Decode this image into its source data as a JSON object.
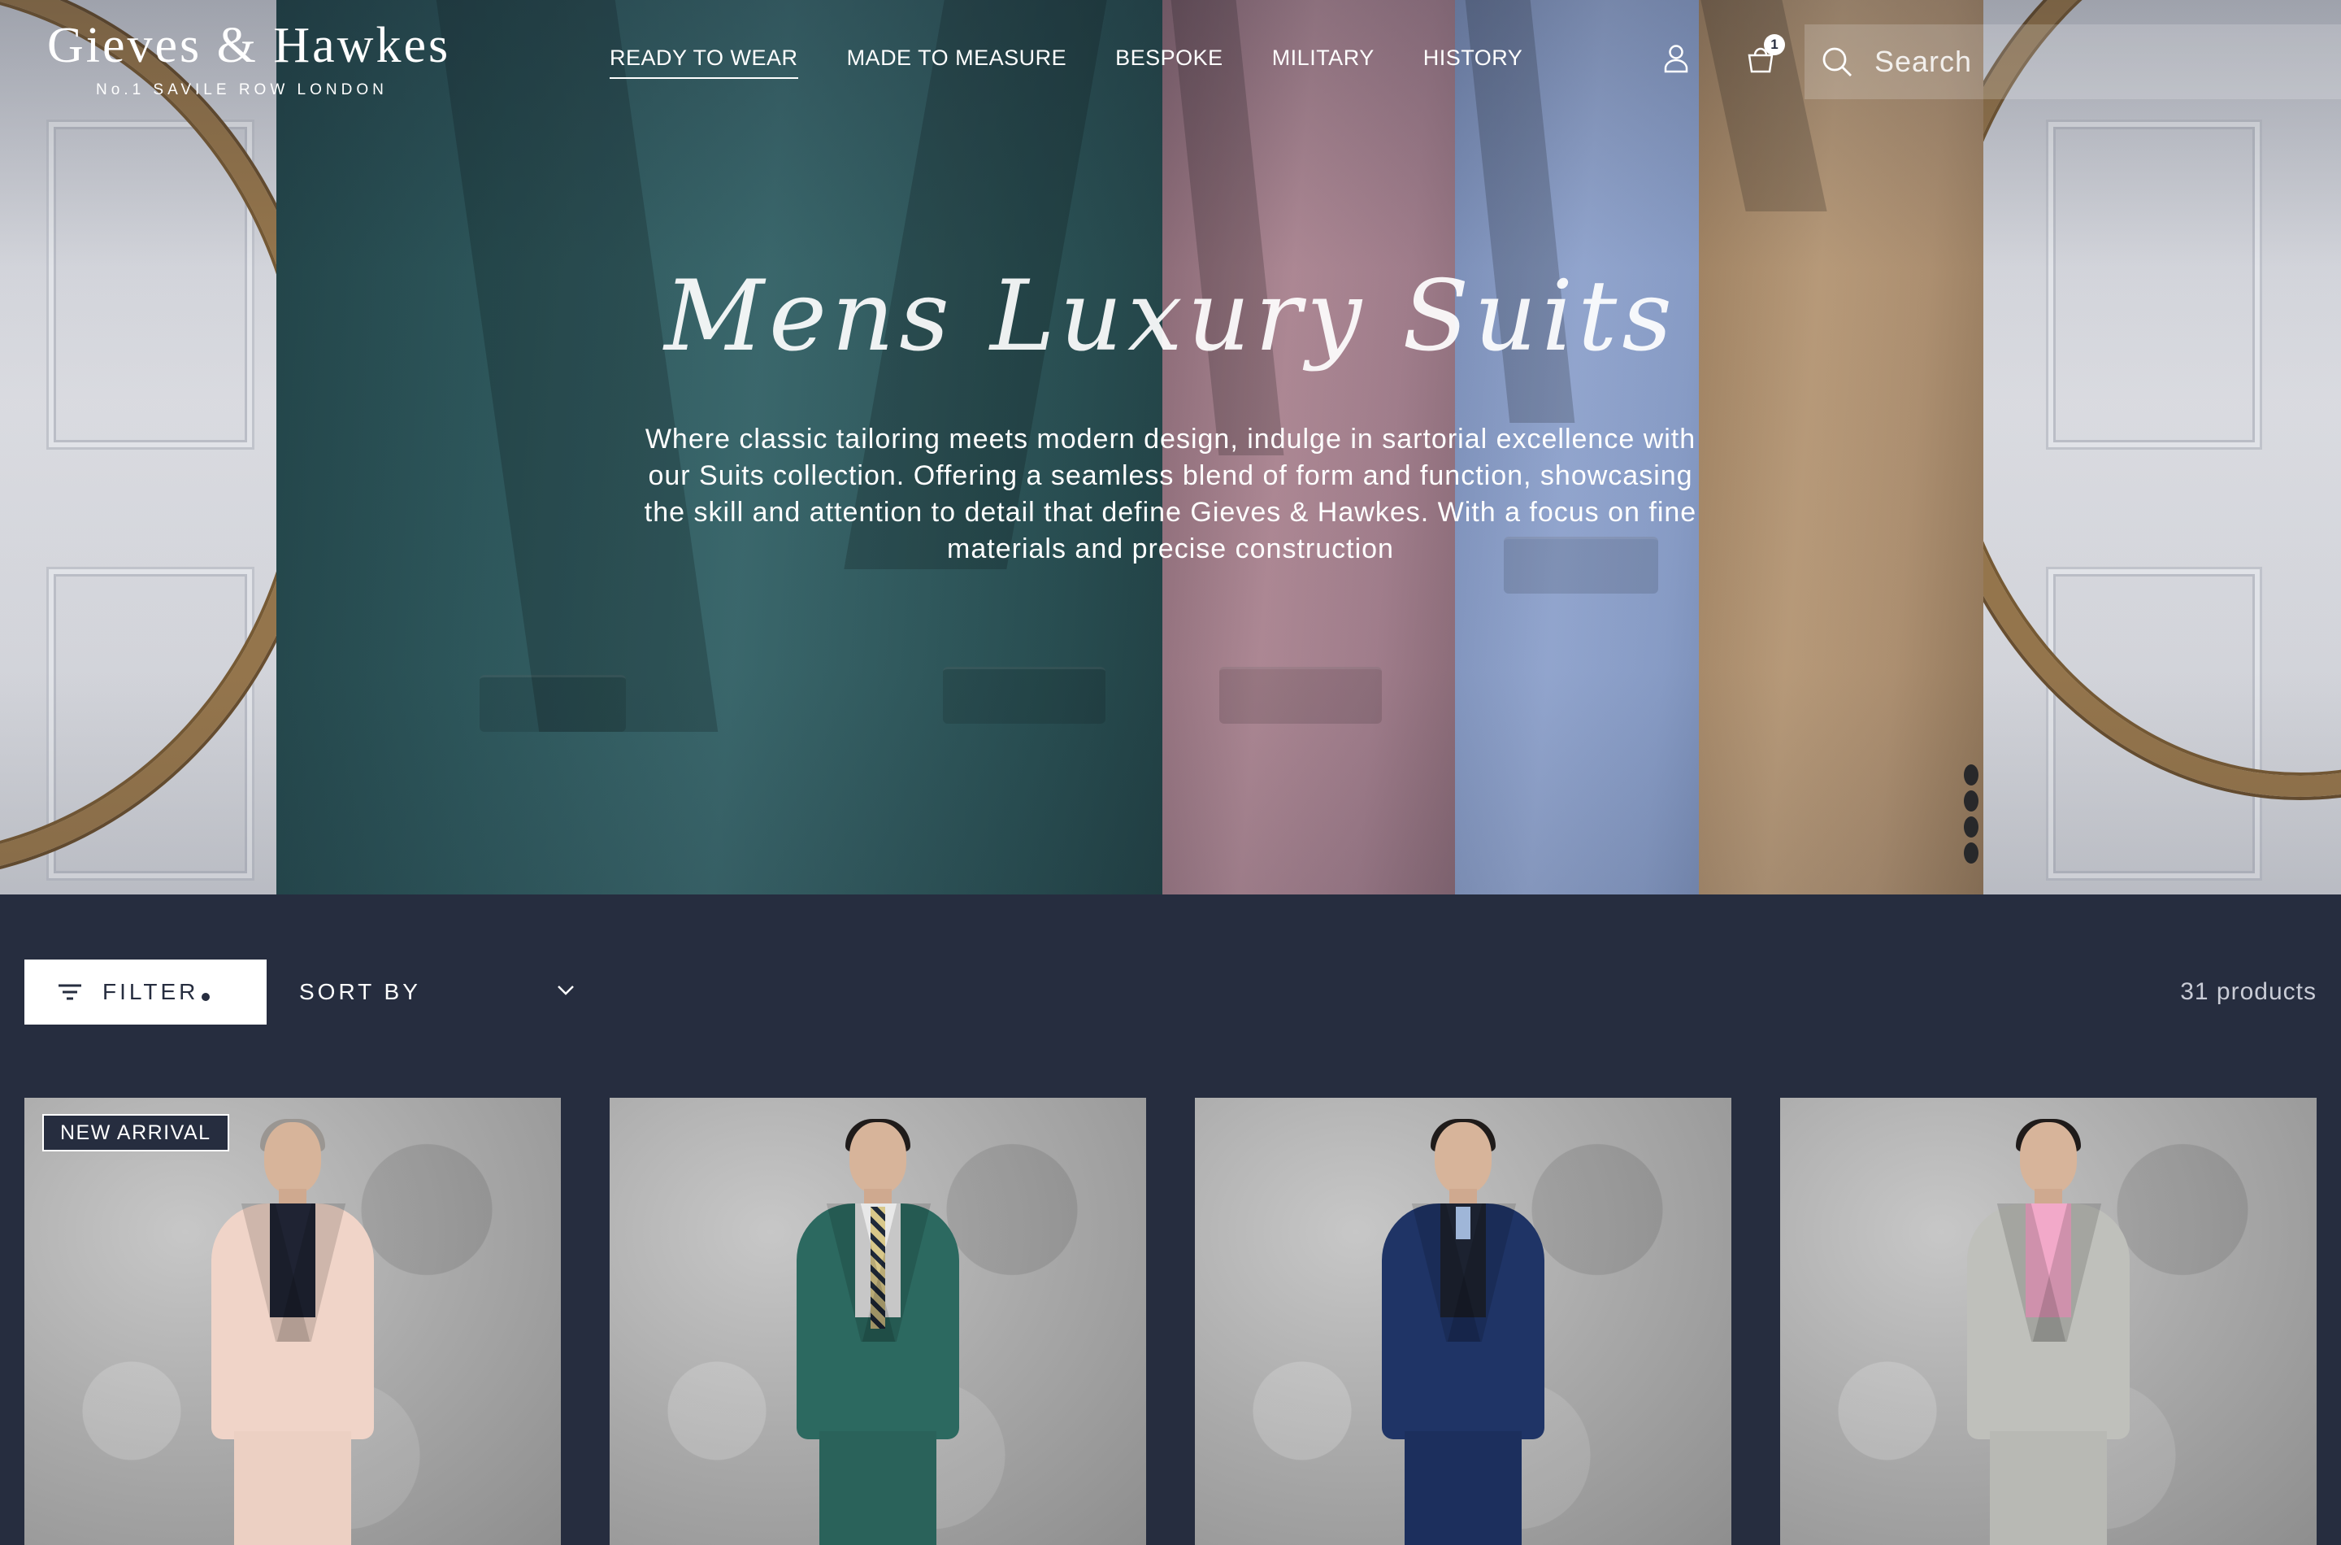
{
  "header": {
    "logo": {
      "main": "Gieves & Hawkes",
      "tagline": "No.1 SAVILE ROW LONDON"
    },
    "nav": [
      {
        "label": "READY TO WEAR",
        "active": true
      },
      {
        "label": "MADE TO MEASURE",
        "active": false
      },
      {
        "label": "BESPOKE",
        "active": false
      },
      {
        "label": "MILITARY",
        "active": false
      },
      {
        "label": "HISTORY",
        "active": false
      }
    ],
    "icons": {
      "account": "user-icon",
      "cart": "basket-icon",
      "search": "search-icon"
    },
    "cart_count": "1",
    "search": {
      "placeholder": "Search",
      "value": ""
    }
  },
  "hero": {
    "title": "Mens Luxury Suits",
    "description": "Where classic tailoring meets modern design, indulge in sartorial excellence with our Suits collection. Offering a seamless blend of form and function, showcasing the skill and attention to detail that define Gieves & Hawkes. With a focus on fine materials and precise construction"
  },
  "toolbar": {
    "filter_label": "FILTER",
    "filter_icon": "filter-lines-icon",
    "sort_label": "SORT BY",
    "sort_icon": "chevron-down-icon",
    "product_count": "31 products"
  },
  "products": [
    {
      "badge": "NEW ARRIVAL",
      "jacket_color": "#f0d4c8",
      "shirt_color": "#1f2333",
      "trouser_color": "#ecd0c3"
    },
    {
      "badge": "",
      "jacket_color": "#2c6960",
      "shirt_color": "#e8e8e8",
      "trouser_color": "#2a625a"
    },
    {
      "badge": "",
      "jacket_color": "#1f3466",
      "shirt_color": "#1c2230",
      "trouser_color": "#1c2f5d"
    },
    {
      "badge": "",
      "jacket_color": "#bfc0bb",
      "shirt_color": "#f2a9c9",
      "trouser_color": "#b8b9b4"
    }
  ],
  "colors": {
    "page_background": "#262d3f",
    "filter_button": "#ffffff",
    "text_light": "#ffffff",
    "count_text": "#c9ccd6"
  }
}
